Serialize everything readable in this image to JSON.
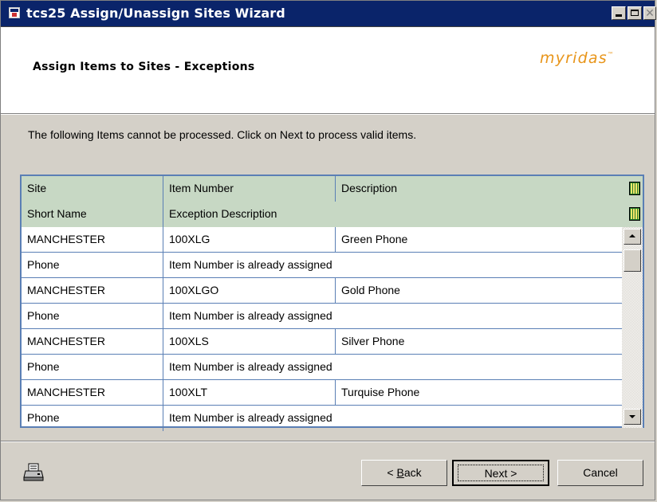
{
  "window": {
    "title": "tcs25 Assign/Unassign Sites Wizard"
  },
  "header": {
    "title": "Assign Items to Sites - Exceptions",
    "logo": "myridas",
    "logo_tm": "™"
  },
  "instruction": "The following Items cannot be processed. Click on Next to process valid items.",
  "grid": {
    "header1": {
      "site": "Site",
      "item_number": "Item Number",
      "description": "Description"
    },
    "header2": {
      "short_name": "Short Name",
      "exception_description": "Exception Description"
    },
    "rows": [
      {
        "site": "MANCHESTER",
        "item_number": "100XLG",
        "description": "Green Phone",
        "short_name": "Phone",
        "exception": "Item Number is already assigned"
      },
      {
        "site": "MANCHESTER",
        "item_number": "100XLGO",
        "description": "Gold Phone",
        "short_name": "Phone",
        "exception": "Item Number is already assigned"
      },
      {
        "site": "MANCHESTER",
        "item_number": "100XLS",
        "description": "Silver Phone",
        "short_name": "Phone",
        "exception": "Item Number is already assigned"
      },
      {
        "site": "MANCHESTER",
        "item_number": "100XLT",
        "description": "Turquise Phone",
        "short_name": "Phone",
        "exception": "Item Number is already assigned"
      }
    ]
  },
  "buttons": {
    "back_underlined": "B",
    "back_label": "ack",
    "back_prefix": "< ",
    "next_label": "Next >",
    "cancel_label": "Cancel"
  },
  "icons": {
    "app": "app-window-icon",
    "printer": "printer-icon",
    "grid_header": "column-expand-icon"
  }
}
